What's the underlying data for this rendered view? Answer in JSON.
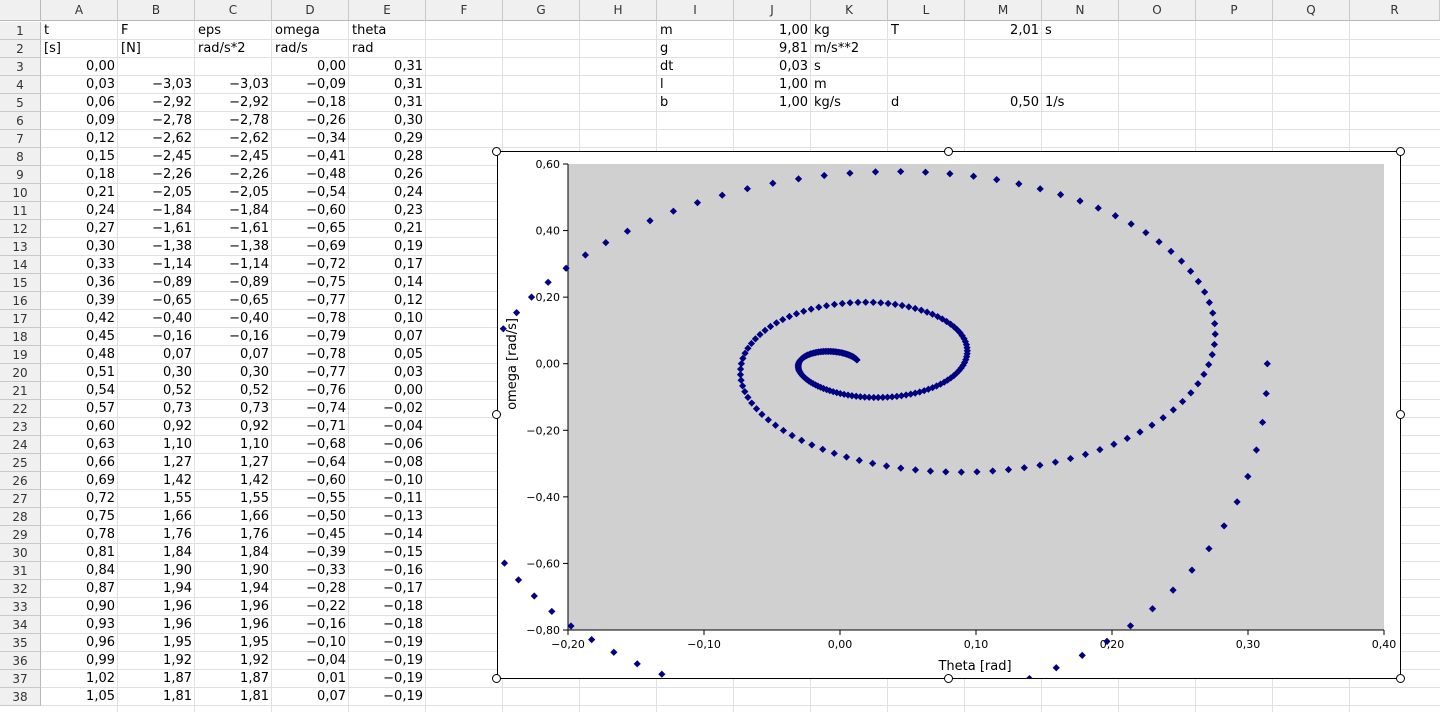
{
  "columns": [
    "A",
    "B",
    "C",
    "D",
    "E",
    "F",
    "G",
    "H",
    "I",
    "J",
    "K",
    "L",
    "M",
    "N",
    "O",
    "P",
    "Q",
    "R"
  ],
  "rows": [
    "1",
    "2",
    "3",
    "4",
    "5",
    "6",
    "7",
    "8",
    "9",
    "10",
    "11",
    "12",
    "13",
    "14",
    "15",
    "16",
    "17",
    "18",
    "19",
    "20",
    "21",
    "22",
    "23",
    "24",
    "25",
    "26",
    "27",
    "28",
    "29",
    "30",
    "31",
    "32",
    "33",
    "34",
    "35",
    "36",
    "37",
    "38"
  ],
  "headers": {
    "row1": [
      "t",
      "F",
      "eps",
      "omega",
      "theta"
    ],
    "row2": [
      "[s]",
      "[N]",
      "rad/s*2",
      "rad/s",
      "rad"
    ]
  },
  "table": [
    [
      "0,00",
      "",
      "",
      "0,00",
      "0,31"
    ],
    [
      "0,03",
      "−3,03",
      "−3,03",
      "−0,09",
      "0,31"
    ],
    [
      "0,06",
      "−2,92",
      "−2,92",
      "−0,18",
      "0,31"
    ],
    [
      "0,09",
      "−2,78",
      "−2,78",
      "−0,26",
      "0,30"
    ],
    [
      "0,12",
      "−2,62",
      "−2,62",
      "−0,34",
      "0,29"
    ],
    [
      "0,15",
      "−2,45",
      "−2,45",
      "−0,41",
      "0,28"
    ],
    [
      "0,18",
      "−2,26",
      "−2,26",
      "−0,48",
      "0,26"
    ],
    [
      "0,21",
      "−2,05",
      "−2,05",
      "−0,54",
      "0,24"
    ],
    [
      "0,24",
      "−1,84",
      "−1,84",
      "−0,60",
      "0,23"
    ],
    [
      "0,27",
      "−1,61",
      "−1,61",
      "−0,65",
      "0,21"
    ],
    [
      "0,30",
      "−1,38",
      "−1,38",
      "−0,69",
      "0,19"
    ],
    [
      "0,33",
      "−1,14",
      "−1,14",
      "−0,72",
      "0,17"
    ],
    [
      "0,36",
      "−0,89",
      "−0,89",
      "−0,75",
      "0,14"
    ],
    [
      "0,39",
      "−0,65",
      "−0,65",
      "−0,77",
      "0,12"
    ],
    [
      "0,42",
      "−0,40",
      "−0,40",
      "−0,78",
      "0,10"
    ],
    [
      "0,45",
      "−0,16",
      "−0,16",
      "−0,79",
      "0,07"
    ],
    [
      "0,48",
      "0,07",
      "0,07",
      "−0,78",
      "0,05"
    ],
    [
      "0,51",
      "0,30",
      "0,30",
      "−0,77",
      "0,03"
    ],
    [
      "0,54",
      "0,52",
      "0,52",
      "−0,76",
      "0,00"
    ],
    [
      "0,57",
      "0,73",
      "0,73",
      "−0,74",
      "−0,02"
    ],
    [
      "0,60",
      "0,92",
      "0,92",
      "−0,71",
      "−0,04"
    ],
    [
      "0,63",
      "1,10",
      "1,10",
      "−0,68",
      "−0,06"
    ],
    [
      "0,66",
      "1,27",
      "1,27",
      "−0,64",
      "−0,08"
    ],
    [
      "0,69",
      "1,42",
      "1,42",
      "−0,60",
      "−0,10"
    ],
    [
      "0,72",
      "1,55",
      "1,55",
      "−0,55",
      "−0,11"
    ],
    [
      "0,75",
      "1,66",
      "1,66",
      "−0,50",
      "−0,13"
    ],
    [
      "0,78",
      "1,76",
      "1,76",
      "−0,45",
      "−0,14"
    ],
    [
      "0,81",
      "1,84",
      "1,84",
      "−0,39",
      "−0,15"
    ],
    [
      "0,84",
      "1,90",
      "1,90",
      "−0,33",
      "−0,16"
    ],
    [
      "0,87",
      "1,94",
      "1,94",
      "−0,28",
      "−0,17"
    ],
    [
      "0,90",
      "1,96",
      "1,96",
      "−0,22",
      "−0,18"
    ],
    [
      "0,93",
      "1,96",
      "1,96",
      "−0,16",
      "−0,18"
    ],
    [
      "0,96",
      "1,95",
      "1,95",
      "−0,10",
      "−0,19"
    ],
    [
      "0,99",
      "1,92",
      "1,92",
      "−0,04",
      "−0,19"
    ],
    [
      "1,02",
      "1,87",
      "1,87",
      "0,01",
      "−0,19"
    ],
    [
      "1,05",
      "1,81",
      "1,81",
      "0,07",
      "−0,19"
    ]
  ],
  "params": [
    {
      "name": "m",
      "value": "1,00",
      "unit": "kg"
    },
    {
      "name": "g",
      "value": "9,81",
      "unit": "m/s**2"
    },
    {
      "name": "dt",
      "value": "0,03",
      "unit": "s"
    },
    {
      "name": "l",
      "value": "1,00",
      "unit": "m"
    },
    {
      "name": "b",
      "value": "1,00",
      "unit": "kg/s"
    }
  ],
  "params2": [
    {
      "name": "T",
      "value": "2,01",
      "unit": "s"
    },
    {
      "name": "d",
      "value": "0,50",
      "unit": "1/s"
    }
  ],
  "chart_data": {
    "type": "scatter",
    "xlabel": "Theta [rad]",
    "ylabel": "omega [rad/s]",
    "xlim": [
      -0.2,
      0.4
    ],
    "ylim": [
      -0.8,
      0.6
    ],
    "xticks": [
      "−0,20",
      "−0,10",
      "0,00",
      "0,10",
      "0,20",
      "0,30",
      "0,40"
    ],
    "yticks": [
      "0,60",
      "0,40",
      "0,20",
      "0,00",
      "−0,20",
      "−0,40",
      "−0,60",
      "−0,80"
    ],
    "marker_color": "#000080",
    "plot_bg": "#d0d0d0",
    "legend": "none",
    "grid": false,
    "points": [
      [
        0.3142,
        0.0
      ],
      [
        0.3134,
        -0.0897
      ],
      [
        0.3107,
        -0.1761
      ],
      [
        0.3062,
        -0.2592
      ],
      [
        0.2999,
        -0.3389
      ],
      [
        0.292,
        -0.415
      ],
      [
        0.2824,
        -0.4873
      ],
      [
        0.2713,
        -0.5557
      ],
      [
        0.2588,
        -0.6201
      ],
      [
        0.2449,
        -0.6802
      ],
      [
        0.2298,
        -0.7361
      ],
      [
        0.2136,
        -0.7874
      ],
      [
        0.1963,
        -0.8342
      ],
      [
        0.1781,
        -0.8762
      ],
      [
        0.159,
        -0.9135
      ],
      [
        0.1393,
        -0.9459
      ],
      [
        0.1189,
        -0.9734
      ],
      [
        0.0981,
        -0.996
      ],
      [
        0.0769,
        -1.0137
      ],
      [
        0.0555,
        -1.0265
      ],
      [
        0.0339,
        -1.0344
      ],
      [
        0.0123,
        -1.0375
      ],
      [
        -0.0092,
        -1.0358
      ],
      [
        -0.0305,
        -1.0295
      ],
      [
        -0.0516,
        -1.0187
      ],
      [
        -0.0723,
        -1.0034
      ],
      [
        -0.0925,
        -0.9839
      ],
      [
        -0.1121,
        -0.9603
      ],
      [
        -0.131,
        -0.9328
      ],
      [
        -0.1491,
        -0.9016
      ],
      [
        -0.1663,
        -0.8669
      ],
      [
        -0.1826,
        -0.8289
      ],
      [
        -0.1978,
        -0.7879
      ],
      [
        -0.2119,
        -0.7442
      ],
      [
        -0.2248,
        -0.6979
      ],
      [
        -0.2364,
        -0.6494
      ],
      [
        -0.2467,
        -0.599
      ],
      [
        -0.2556,
        -0.5469
      ],
      [
        -0.2631,
        -0.4934
      ],
      [
        -0.2692,
        -0.4388
      ],
      [
        -0.2737,
        -0.3835
      ],
      [
        -0.2768,
        -0.3276
      ],
      [
        -0.2783,
        -0.2715
      ],
      [
        -0.2783,
        -0.2154
      ],
      [
        -0.2768,
        -0.1597
      ],
      [
        -0.2738,
        -0.1046
      ],
      [
        -0.2693,
        -0.0503
      ],
      [
        -0.2634,
        0.0028
      ],
      [
        -0.2562,
        0.0546
      ],
      [
        -0.2476,
        0.1049
      ],
      [
        -0.2378,
        0.1535
      ],
      [
        -0.2268,
        0.2001
      ],
      [
        -0.2146,
        0.2446
      ],
      [
        -0.2014,
        0.2868
      ],
      [
        -0.1872,
        0.3266
      ],
      [
        -0.1722,
        0.3637
      ],
      [
        -0.1563,
        0.3981
      ],
      [
        -0.1397,
        0.4296
      ],
      [
        -0.1225,
        0.4582
      ],
      [
        -0.1048,
        0.4838
      ],
      [
        -0.0866,
        0.5063
      ],
      [
        -0.0681,
        0.5258
      ],
      [
        -0.0494,
        0.5421
      ],
      [
        -0.0305,
        0.5553
      ],
      [
        -0.0116,
        0.5654
      ],
      [
        0.0073,
        0.5724
      ],
      [
        0.0261,
        0.5764
      ],
      [
        0.0446,
        0.5773
      ],
      [
        0.0629,
        0.5754
      ],
      [
        0.0808,
        0.5706
      ],
      [
        0.0982,
        0.5631
      ],
      [
        0.1152,
        0.553
      ],
      [
        0.1315,
        0.5404
      ],
      [
        0.1472,
        0.5254
      ],
      [
        0.1622,
        0.5081
      ],
      [
        0.1765,
        0.4888
      ],
      [
        0.1899,
        0.4676
      ],
      [
        0.2025,
        0.4445
      ],
      [
        0.2141,
        0.4198
      ],
      [
        0.2249,
        0.3937
      ],
      [
        0.2346,
        0.3662
      ],
      [
        0.2434,
        0.3376
      ],
      [
        0.2511,
        0.3081
      ],
      [
        0.2578,
        0.2778
      ],
      [
        0.2635,
        0.2469
      ],
      [
        0.2681,
        0.2155
      ],
      [
        0.2716,
        0.1839
      ],
      [
        0.2741,
        0.1522
      ],
      [
        0.2755,
        0.1205
      ],
      [
        0.2759,
        0.089
      ],
      [
        0.2753,
        0.0579
      ],
      [
        0.2737,
        0.0273
      ],
      [
        0.2711,
        -0.0027
      ],
      [
        0.2676,
        -0.0319
      ],
      [
        0.2632,
        -0.0602
      ],
      [
        0.258,
        -0.0875
      ],
      [
        0.2519,
        -0.1137
      ],
      [
        0.2451,
        -0.1387
      ],
      [
        0.2376,
        -0.1623
      ],
      [
        0.2294,
        -0.1845
      ],
      [
        0.2206,
        -0.2052
      ],
      [
        0.2112,
        -0.2244
      ],
      [
        0.2014,
        -0.242
      ],
      [
        0.1911,
        -0.258
      ],
      [
        0.1805,
        -0.2723
      ],
      [
        0.1695,
        -0.2849
      ],
      [
        0.1584,
        -0.2958
      ],
      [
        0.147,
        -0.3049
      ],
      [
        0.1355,
        -0.3124
      ],
      [
        0.1239,
        -0.3182
      ],
      [
        0.1123,
        -0.3223
      ],
      [
        0.1007,
        -0.3248
      ],
      [
        0.0892,
        -0.3256
      ],
      [
        0.0778,
        -0.3249
      ],
      [
        0.0665,
        -0.3226
      ],
      [
        0.0555,
        -0.3189
      ],
      [
        0.0447,
        -0.3137
      ],
      [
        0.0342,
        -0.3072
      ],
      [
        0.024,
        -0.2995
      ],
      [
        0.0142,
        -0.2905
      ],
      [
        0.0048,
        -0.2804
      ],
      [
        -0.0042,
        -0.2692
      ],
      [
        -0.0127,
        -0.2571
      ],
      [
        -0.0207,
        -0.244
      ],
      [
        -0.0282,
        -0.2302
      ],
      [
        -0.0352,
        -0.2157
      ],
      [
        -0.0416,
        -0.2005
      ],
      [
        -0.0474,
        -0.1848
      ],
      [
        -0.0527,
        -0.1686
      ],
      [
        -0.0574,
        -0.1521
      ],
      [
        -0.0614,
        -0.1353
      ],
      [
        -0.0649,
        -0.1182
      ],
      [
        -0.0677,
        -0.1011
      ],
      [
        -0.07,
        -0.0839
      ],
      [
        -0.0716,
        -0.0667
      ],
      [
        -0.0727,
        -0.0496
      ],
      [
        -0.0732,
        -0.0327
      ],
      [
        -0.0731,
        -0.0161
      ],
      [
        -0.0725,
        0.0002
      ],
      [
        -0.0714,
        0.0161
      ],
      [
        -0.0698,
        0.0316
      ],
      [
        -0.0677,
        0.0465
      ],
      [
        -0.0651,
        0.0609
      ],
      [
        -0.0622,
        0.0747
      ],
      [
        -0.0588,
        0.0878
      ],
      [
        -0.0551,
        0.1001
      ],
      [
        -0.0511,
        0.1118
      ],
      [
        -0.0467,
        0.1226
      ],
      [
        -0.0421,
        0.1326
      ],
      [
        -0.0372,
        0.1418
      ],
      [
        -0.032,
        0.1501
      ],
      [
        -0.0267,
        0.1575
      ],
      [
        -0.0212,
        0.164
      ],
      [
        -0.0156,
        0.1696
      ],
      [
        -0.0099,
        0.1743
      ],
      [
        -0.0041,
        0.1781
      ],
      [
        0.0017,
        0.181
      ],
      [
        0.0074,
        0.1831
      ],
      [
        0.0132,
        0.1843
      ],
      [
        0.0189,
        0.1846
      ],
      [
        0.0245,
        0.1842
      ],
      [
        0.03,
        0.1829
      ],
      [
        0.0354,
        0.1809
      ],
      [
        0.0406,
        0.1782
      ],
      [
        0.0457,
        0.1748
      ],
      [
        0.0506,
        0.1707
      ],
      [
        0.0553,
        0.166
      ],
      [
        0.0598,
        0.1607
      ],
      [
        0.064,
        0.1549
      ],
      [
        0.068,
        0.1485
      ],
      [
        0.0718,
        0.1417
      ],
      [
        0.0752,
        0.1345
      ],
      [
        0.0784,
        0.1268
      ],
      [
        0.0813,
        0.1189
      ],
      [
        0.0839,
        0.1106
      ],
      [
        0.0862,
        0.1021
      ],
      [
        0.0882,
        0.0934
      ],
      [
        0.0898,
        0.0845
      ],
      [
        0.0912,
        0.0755
      ],
      [
        0.0922,
        0.0664
      ],
      [
        0.093,
        0.0572
      ],
      [
        0.0934,
        0.0481
      ],
      [
        0.0936,
        0.039
      ],
      [
        0.0935,
        0.03
      ],
      [
        0.0931,
        0.021
      ],
      [
        0.0925,
        0.0123
      ],
      [
        0.0916,
        0.0036
      ],
      [
        0.0905,
        -0.0048
      ],
      [
        0.0891,
        -0.0129
      ],
      [
        0.0875,
        -0.0208
      ],
      [
        0.0857,
        -0.0284
      ],
      [
        0.0837,
        -0.0357
      ],
      [
        0.0815,
        -0.0427
      ],
      [
        0.0791,
        -0.0493
      ],
      [
        0.0766,
        -0.0555
      ],
      [
        0.0739,
        -0.0614
      ],
      [
        0.071,
        -0.0669
      ],
      [
        0.0681,
        -0.072
      ],
      [
        0.065,
        -0.0767
      ],
      [
        0.0619,
        -0.081
      ],
      [
        0.0586,
        -0.0849
      ],
      [
        0.0553,
        -0.0883
      ],
      [
        0.052,
        -0.0914
      ],
      [
        0.0486,
        -0.094
      ],
      [
        0.0452,
        -0.0963
      ],
      [
        0.0418,
        -0.0981
      ],
      [
        0.0383,
        -0.0995
      ],
      [
        0.0349,
        -0.1006
      ],
      [
        0.0315,
        -0.1012
      ],
      [
        0.0281,
        -0.1015
      ],
      [
        0.0248,
        -0.1014
      ],
      [
        0.0214,
        -0.101
      ],
      [
        0.0182,
        -0.1003
      ],
      [
        0.015,
        -0.0992
      ],
      [
        0.0119,
        -0.0978
      ],
      [
        0.0088,
        -0.0962
      ],
      [
        0.0059,
        -0.0942
      ],
      [
        0.003,
        -0.092
      ],
      [
        0.0002,
        -0.0896
      ],
      [
        -0.0024,
        -0.0869
      ],
      [
        -0.005,
        -0.0841
      ],
      [
        -0.0075,
        -0.081
      ],
      [
        -0.0098,
        -0.0778
      ],
      [
        -0.0121,
        -0.0744
      ],
      [
        -0.0142,
        -0.0709
      ],
      [
        -0.0162,
        -0.0673
      ],
      [
        -0.018,
        -0.0636
      ],
      [
        -0.0198,
        -0.0598
      ],
      [
        -0.0214,
        -0.0559
      ],
      [
        -0.0229,
        -0.052
      ],
      [
        -0.0242,
        -0.048
      ],
      [
        -0.0254,
        -0.0441
      ],
      [
        -0.0265,
        -0.0401
      ],
      [
        -0.0275,
        -0.0361
      ],
      [
        -0.0283,
        -0.0321
      ],
      [
        -0.029,
        -0.0282
      ],
      [
        -0.0296,
        -0.0243
      ],
      [
        -0.0301,
        -0.0205
      ],
      [
        -0.0304,
        -0.0167
      ],
      [
        -0.0306,
        -0.013
      ],
      [
        -0.0307,
        -0.0094
      ],
      [
        -0.0307,
        -0.0059
      ],
      [
        -0.0306,
        -0.0025
      ],
      [
        -0.0304,
        0.0008
      ],
      [
        -0.0301,
        0.0039
      ],
      [
        -0.0297,
        0.007
      ],
      [
        -0.0292,
        0.0099
      ],
      [
        -0.0286,
        0.0126
      ],
      [
        -0.028,
        0.0153
      ],
      [
        -0.0272,
        0.0177
      ],
      [
        -0.0264,
        0.0201
      ],
      [
        -0.0256,
        0.0223
      ],
      [
        -0.0247,
        0.0243
      ],
      [
        -0.0237,
        0.0262
      ],
      [
        -0.0226,
        0.0279
      ],
      [
        -0.0216,
        0.0295
      ],
      [
        -0.0205,
        0.0309
      ],
      [
        -0.0193,
        0.0322
      ],
      [
        -0.0182,
        0.0333
      ],
      [
        -0.017,
        0.0343
      ],
      [
        -0.0158,
        0.0351
      ],
      [
        -0.0145,
        0.0358
      ],
      [
        -0.0133,
        0.0363
      ],
      [
        -0.0121,
        0.0367
      ],
      [
        -0.0108,
        0.037
      ],
      [
        -0.0096,
        0.0371
      ],
      [
        -0.0084,
        0.0371
      ],
      [
        -0.0071,
        0.037
      ],
      [
        -0.0059,
        0.0367
      ],
      [
        -0.0047,
        0.0364
      ],
      [
        -0.0036,
        0.0359
      ],
      [
        -0.0024,
        0.0353
      ],
      [
        -0.0013,
        0.0347
      ],
      [
        -0.0002,
        0.0339
      ],
      [
        0.0009,
        0.0331
      ],
      [
        0.0019,
        0.0321
      ],
      [
        0.0029,
        0.0311
      ],
      [
        0.0038,
        0.0301
      ],
      [
        0.0047,
        0.0289
      ],
      [
        0.0056,
        0.0278
      ],
      [
        0.0064,
        0.0265
      ],
      [
        0.0072,
        0.0252
      ],
      [
        0.0079,
        0.0239
      ],
      [
        0.0086,
        0.0226
      ],
      [
        0.0093,
        0.0212
      ],
      [
        0.0099,
        0.0198
      ],
      [
        0.0104,
        0.0184
      ],
      [
        0.0109,
        0.017
      ],
      [
        0.0114,
        0.0155
      ],
      [
        0.0118,
        0.0141
      ],
      [
        0.0122,
        0.0127
      ],
      [
        0.0125,
        0.0113
      ]
    ]
  }
}
